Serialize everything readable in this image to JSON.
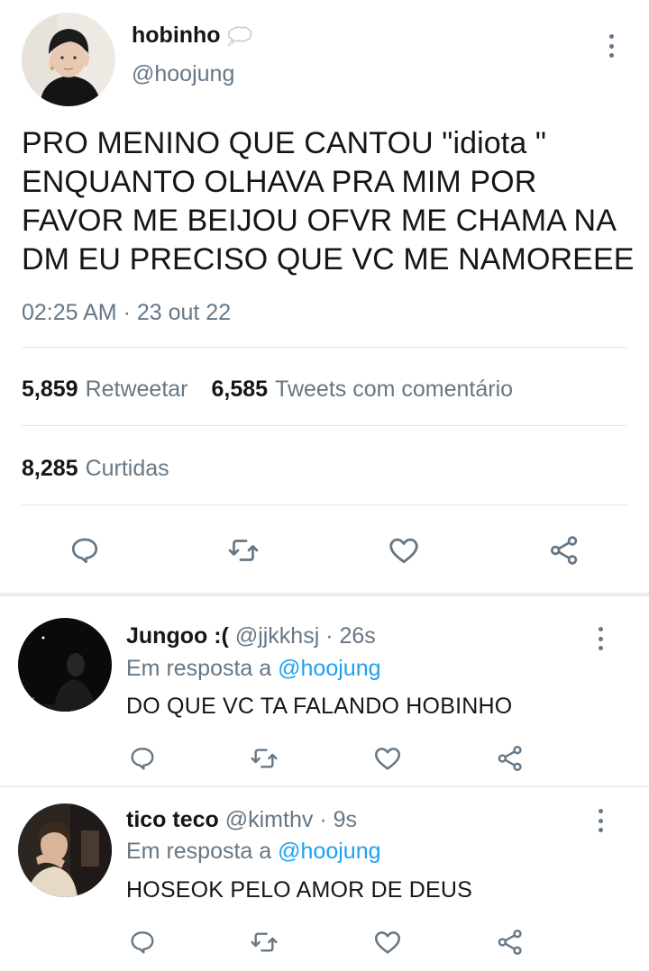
{
  "main_tweet": {
    "author_name": "hobinho",
    "name_icon": "thought-balloon-icon",
    "handle": "@hoojung",
    "text": "PRO MENINO QUE CANTOU \"idiota \"\nENQUANTO OLHAVA PRA MIM POR\nFAVOR ME BEIJOU OFVR ME CHAMA NA\nDM EU PRECISO QUE VC ME NAMOREEE",
    "timestamp": "02:25 AM · 23 out 22",
    "retweets_count": "5,859",
    "retweets_label": "Retweetar",
    "quotes_count": "6,585",
    "quotes_label": "Tweets com comentário",
    "likes_count": "8,285",
    "likes_label": "Curtidas"
  },
  "replies": [
    {
      "author_name": "Jungoo :(",
      "handle": "@jjkkhsj",
      "time": "· 26s",
      "reply_prefix": "Em resposta a",
      "reply_mention": "@hoojung",
      "text": "DO QUE VC TA FALANDO HOBINHO"
    },
    {
      "author_name": "tico teco",
      "handle": "@kimthv",
      "time": "· 9s",
      "reply_prefix": "Em resposta a",
      "reply_mention": "@hoojung",
      "text": "HOSEOK PELO AMOR DE DEUS"
    }
  ],
  "colors": {
    "text": "#14171a",
    "secondary": "#657786",
    "link": "#1da1f2",
    "divider": "#e1e8ed"
  },
  "icons": [
    "reply-icon",
    "retweet-icon",
    "like-icon",
    "share-icon",
    "more-options-icon"
  ]
}
